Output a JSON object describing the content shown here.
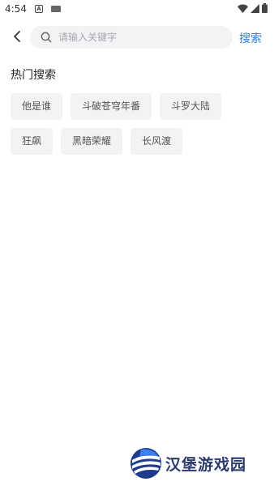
{
  "status_bar": {
    "time": "4:54",
    "notification_icons": [
      "a-badge-icon",
      "keyboard-icon"
    ],
    "system_icons": [
      "wifi-icon",
      "signal-icon",
      "battery-icon"
    ]
  },
  "search": {
    "placeholder": "请输入关键字",
    "value": "",
    "submit_label": "搜索"
  },
  "hot_search": {
    "title": "热门搜索",
    "rows": [
      [
        "他是谁",
        "斗破苍穹年番",
        "斗罗大陆"
      ],
      [
        "狂飙",
        "黑暗荣耀",
        "长风渡"
      ]
    ]
  },
  "watermark": {
    "text": "汉堡游戏园"
  },
  "colors": {
    "accent": "#2f7de1",
    "tag_bg": "#f2f3f5",
    "search_bg": "#f2f3f5"
  }
}
